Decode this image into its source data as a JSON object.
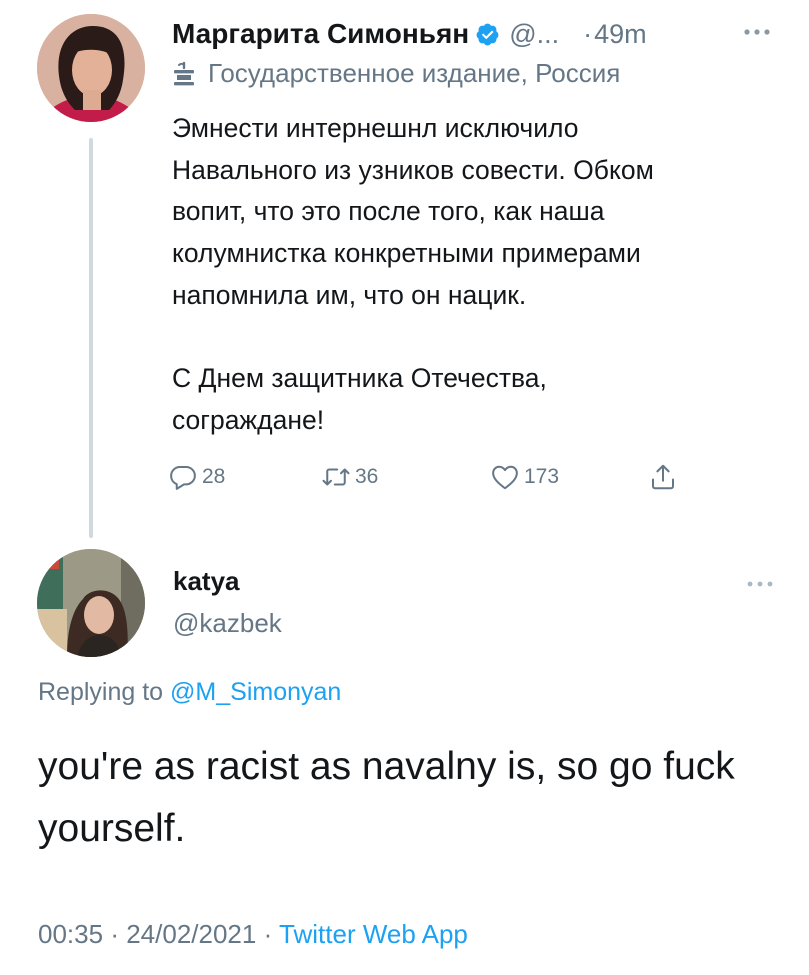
{
  "parent_tweet": {
    "display_name": "Маргарита Симоньян",
    "handle_truncated": "@...",
    "time_separator": "·",
    "time_ago": "49m",
    "state_label": "Государственное издание, Россия",
    "text": "Эмнести интернешнл исключило\nНавального из узников совести. Обком\nвопит, что это после того, как наша\nколумнистка конкретными примерами\nнапомнила им, что он нацик.\n\nС Днем защитника Отечества,\nсограждане!",
    "actions": {
      "replies": "28",
      "retweets": "36",
      "likes": "173"
    }
  },
  "reply_tweet": {
    "display_name": "katya",
    "handle": "@kazbek",
    "replying_prefix": "Replying to",
    "replying_to": "@M_Simonyan",
    "text": "you're as racist as navalny is, so go fuck yourself.",
    "time": "00:35",
    "separator": "·",
    "date": "24/02/2021",
    "app": "Twitter Web App"
  },
  "colors": {
    "link": "#1da1f2",
    "secondary_text": "#657786",
    "primary_text": "#14171a",
    "thread_line": "#cfd9de"
  },
  "icons": [
    "verified-badge-icon",
    "more-icon",
    "state-media-icon",
    "reply-icon",
    "retweet-icon",
    "like-icon",
    "share-icon"
  ]
}
